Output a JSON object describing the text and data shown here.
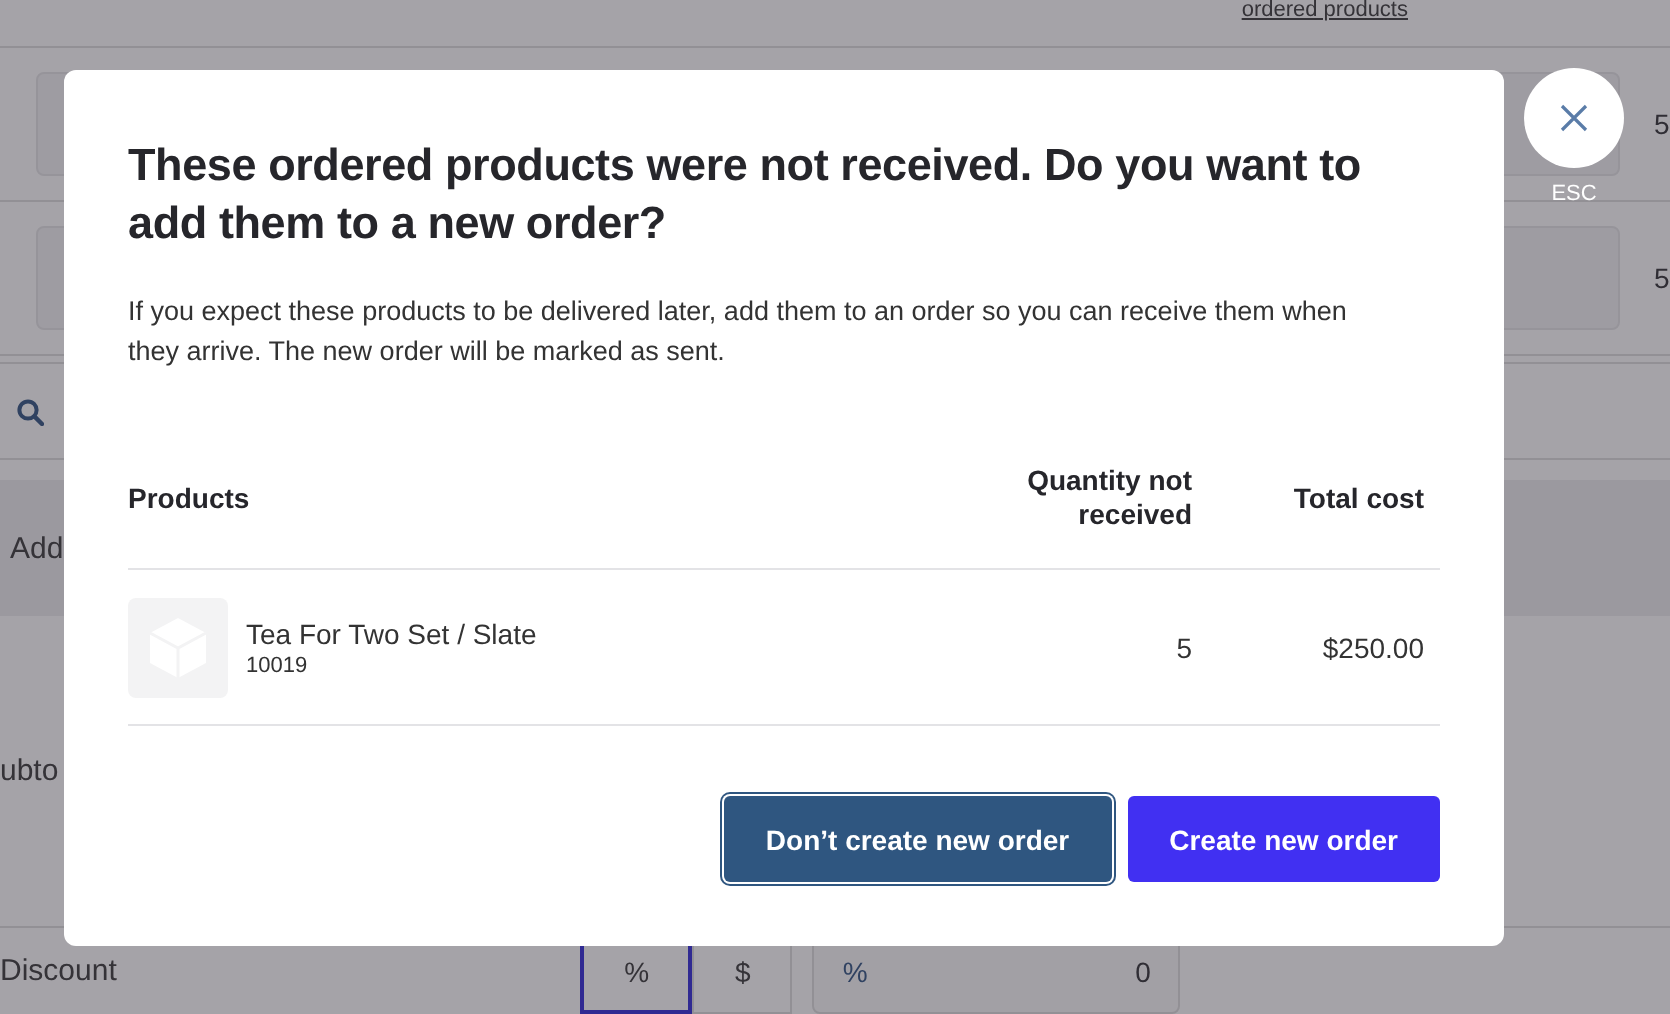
{
  "background": {
    "link": "ordered products",
    "rows": [
      {
        "quantity": "5"
      },
      {
        "quantity": "5"
      }
    ],
    "add_label": "Add",
    "subtotal_label": "ubto",
    "discount": {
      "label": "Discount",
      "options": [
        {
          "label": "%",
          "selected": true
        },
        {
          "label": "$",
          "selected": false
        }
      ],
      "field_prefix": "%",
      "field_value": "0"
    }
  },
  "dialog": {
    "close": {
      "label": "ESC"
    },
    "title": "These ordered products were not received. Do you want to add them to a new order?",
    "description": "If you expect these products to be delivered later, add them to an order so you can receive them when they arrive. The new order will be marked as sent.",
    "table": {
      "columns": [
        "Products",
        "Quantity not received",
        "Total cost"
      ],
      "rows": [
        {
          "name": "Tea For Two Set / Slate",
          "sku": "10019",
          "quantity": "5",
          "total": "$250.00"
        }
      ]
    },
    "buttons": [
      {
        "label": "Don’t create new order",
        "kind": "secondary",
        "focused": true
      },
      {
        "label": "Create new order",
        "kind": "primary",
        "focused": false
      }
    ]
  }
}
